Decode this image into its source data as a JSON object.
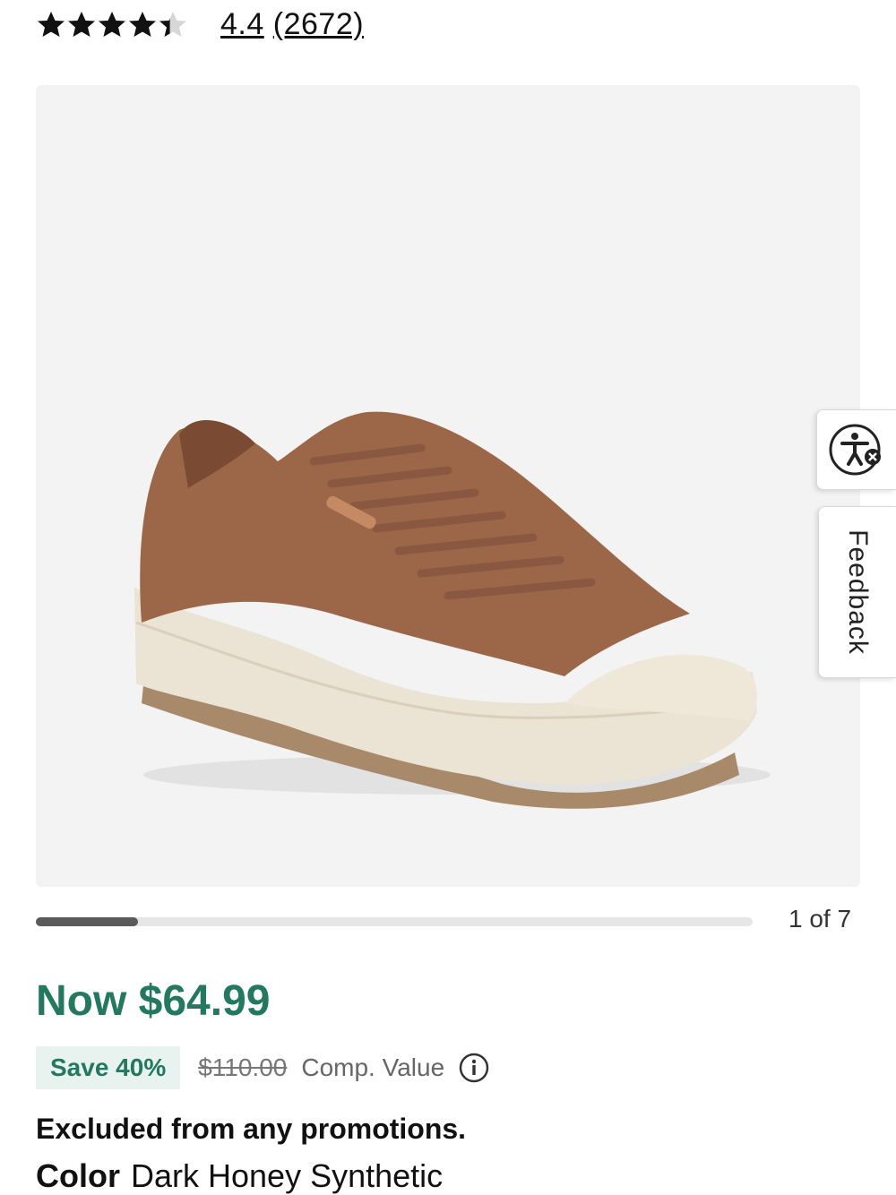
{
  "rating": {
    "value": "4.4",
    "count": "(2672)",
    "stars_filled": 4.4,
    "stars_total": 5
  },
  "gallery": {
    "image_alt": "Dark Honey Synthetic sneaker",
    "counter": "1 of 7",
    "current": 1,
    "total": 7
  },
  "side_tabs": {
    "accessibility_icon": "accessibility-icon",
    "feedback_label": "Feedback"
  },
  "pricing": {
    "now": "Now $64.99",
    "save": "Save 40%",
    "original": "$110.00",
    "comp_label": "Comp. Value",
    "info_icon": "info-icon",
    "accent_color": "#23785f"
  },
  "notice": "Excluded from any promotions.",
  "color": {
    "label": "Color",
    "value": "Dark Honey Synthetic"
  }
}
